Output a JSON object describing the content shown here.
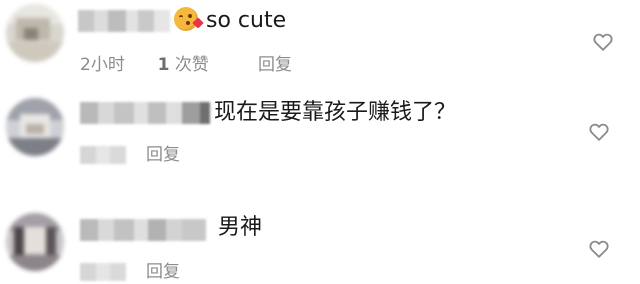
{
  "comments": [
    {
      "emoji": "kissing-face-with-heart",
      "text": "so cute",
      "time": "2小时",
      "likes_count": "1",
      "likes_label": "次赞",
      "reply_label": "回复",
      "like_icon": "heart-outline-icon"
    },
    {
      "text": "现在是要靠孩子赚钱了？",
      "reply_label": "回复",
      "like_icon": "heart-outline-icon"
    },
    {
      "text": "男神",
      "reply_label": "回复",
      "like_icon": "heart-outline-icon"
    }
  ],
  "colors": {
    "text": "#1a1a1a",
    "meta": "#8c8c8c",
    "icon": "#8c8c8c"
  }
}
